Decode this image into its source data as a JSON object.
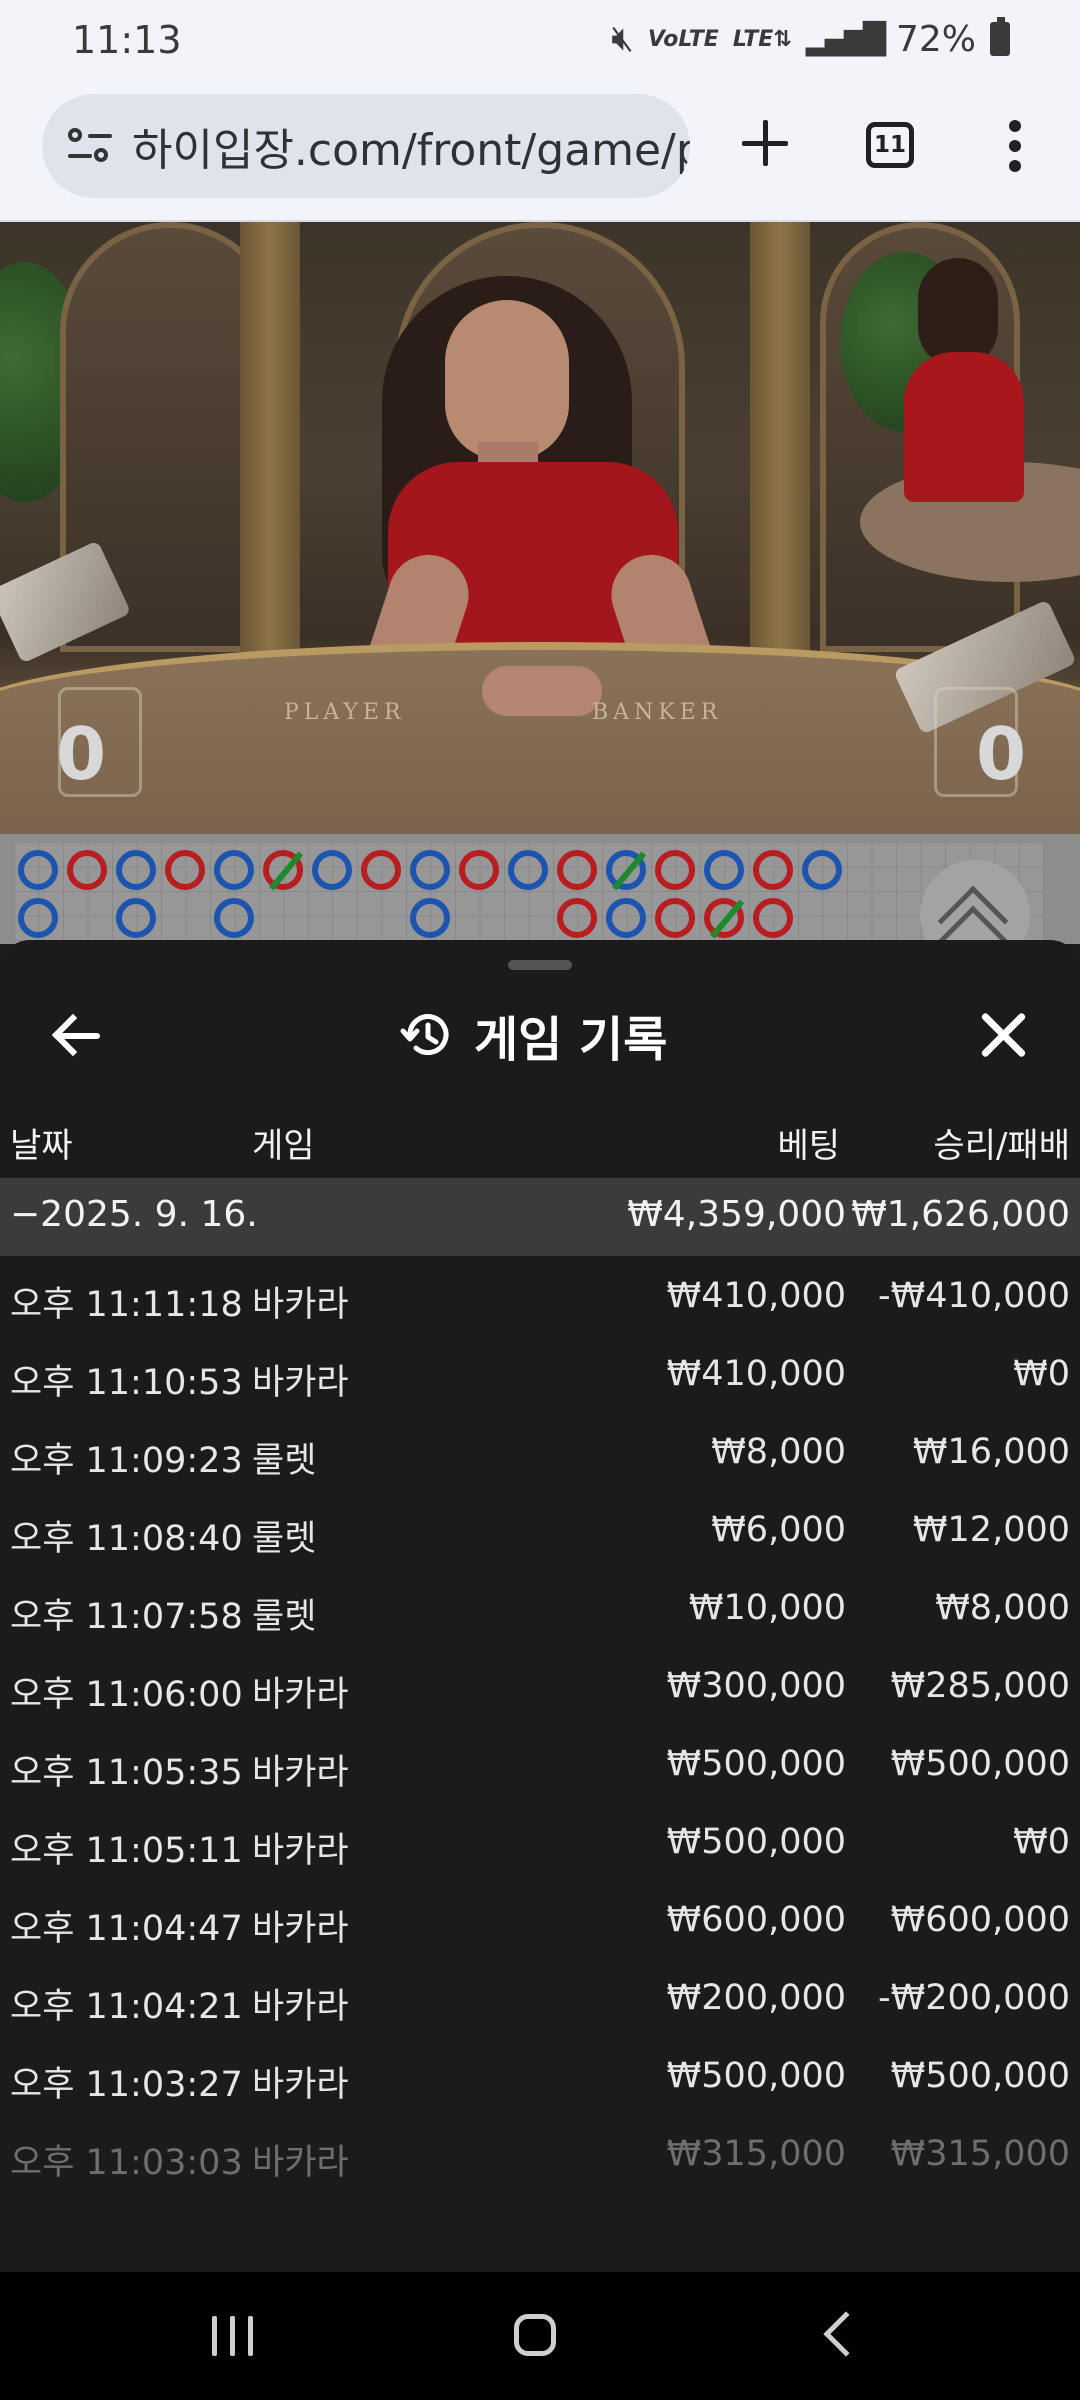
{
  "status_bar": {
    "time": "11:13",
    "network_label": "Vo)) LTE",
    "lte_label": "LTE",
    "battery": "72%"
  },
  "browser": {
    "url": "하이입장.com/front/game/p",
    "tab_count": "11"
  },
  "live_game": {
    "table_labels": {
      "player": "PLAYER",
      "banker": "BANKER"
    },
    "player_score": "0",
    "banker_score": "0"
  },
  "sheet": {
    "title": "게임 기록",
    "columns": {
      "date": "날짜",
      "game": "게임",
      "bet": "베팅",
      "result": "승리/패배"
    },
    "summary": {
      "date": "−2025. 9. 16.",
      "bet": "₩4,359,000",
      "result": "₩1,626,000"
    },
    "rows": [
      {
        "time": "오후 11:11:18",
        "game": "바카라",
        "bet": "₩410,000",
        "result": "-₩410,000"
      },
      {
        "time": "오후 11:10:53",
        "game": "바카라",
        "bet": "₩410,000",
        "result": "₩0"
      },
      {
        "time": "오후 11:09:23",
        "game": "룰렛",
        "bet": "₩8,000",
        "result": "₩16,000"
      },
      {
        "time": "오후 11:08:40",
        "game": "룰렛",
        "bet": "₩6,000",
        "result": "₩12,000"
      },
      {
        "time": "오후 11:07:58",
        "game": "룰렛",
        "bet": "₩10,000",
        "result": "₩8,000"
      },
      {
        "time": "오후 11:06:00",
        "game": "바카라",
        "bet": "₩300,000",
        "result": "₩285,000"
      },
      {
        "time": "오후 11:05:35",
        "game": "바카라",
        "bet": "₩500,000",
        "result": "₩500,000"
      },
      {
        "time": "오후 11:05:11",
        "game": "바카라",
        "bet": "₩500,000",
        "result": "₩0"
      },
      {
        "time": "오후 11:04:47",
        "game": "바카라",
        "bet": "₩600,000",
        "result": "₩600,000"
      },
      {
        "time": "오후 11:04:21",
        "game": "바카라",
        "bet": "₩200,000",
        "result": "-₩200,000"
      },
      {
        "time": "오후 11:03:27",
        "game": "바카라",
        "bet": "₩500,000",
        "result": "₩500,000"
      },
      {
        "time": "오후 11:03:03",
        "game": "바카라",
        "bet": "₩315,000",
        "result": "₩315,000"
      }
    ]
  },
  "colors": {
    "player_bead": "#1c54b0",
    "banker_bead": "#b81e20",
    "tie_mark": "#1d8a2e",
    "sheet_bg": "#1b1b1b"
  }
}
